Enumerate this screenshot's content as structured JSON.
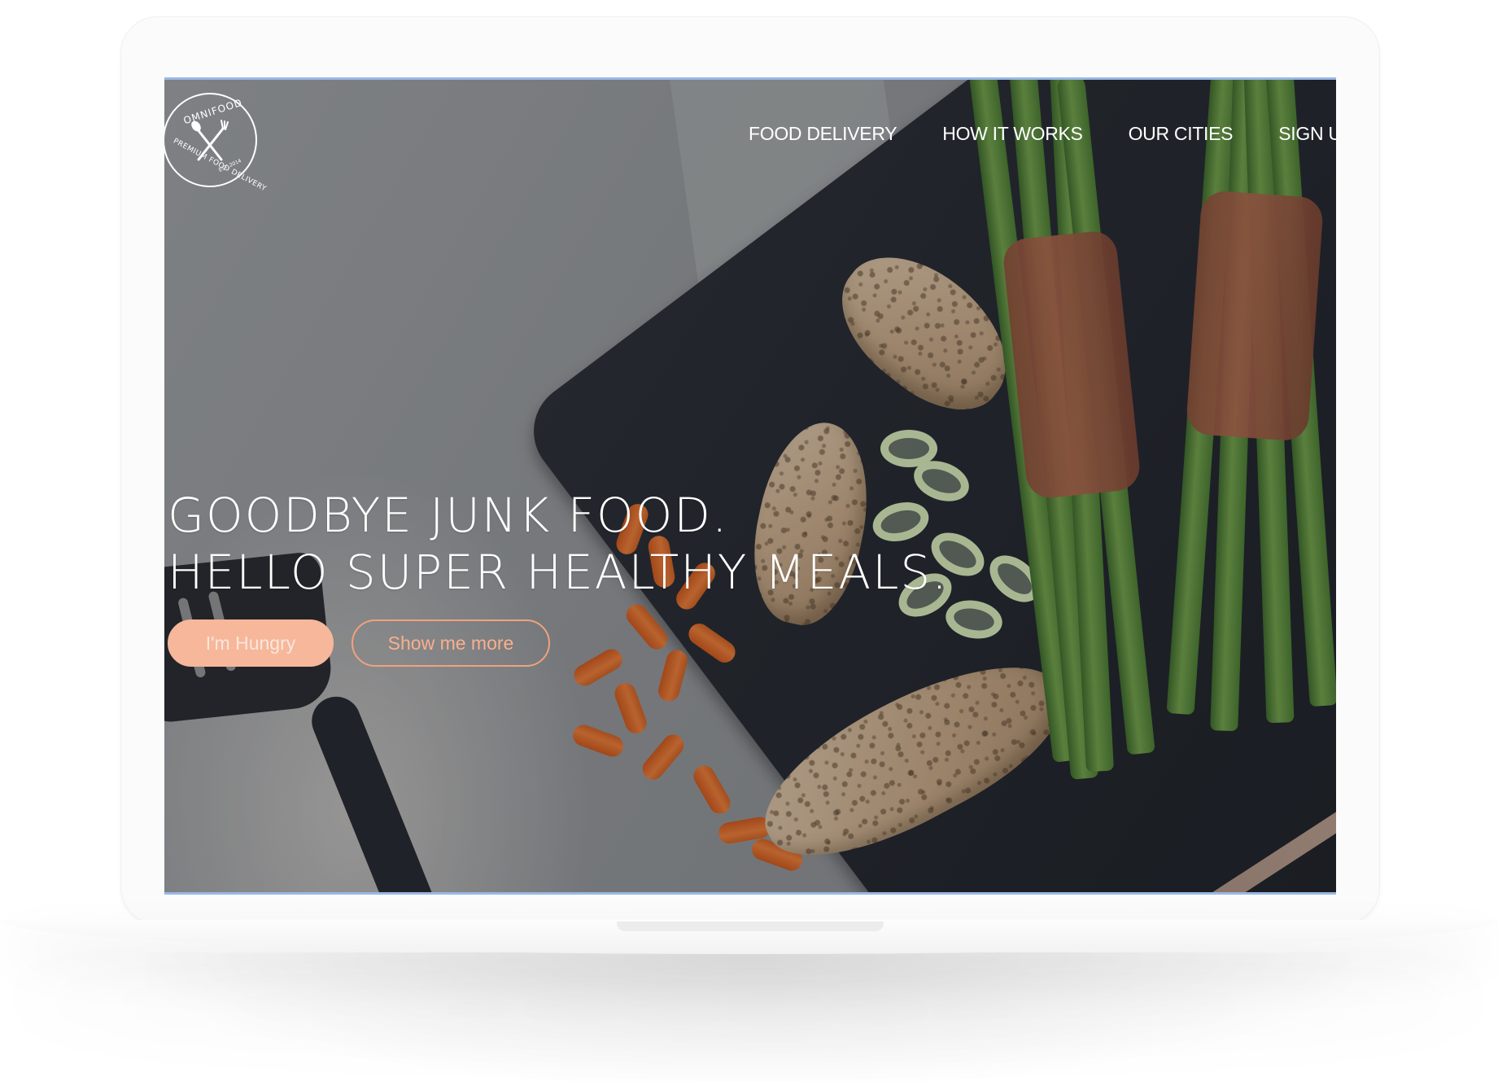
{
  "brand": {
    "name": "OMNIFOOD",
    "tagline": "PREMIUM FOOD DELIVERY",
    "established": "EST. 2014"
  },
  "nav": {
    "items": [
      {
        "label": "FOOD DELIVERY"
      },
      {
        "label": "HOW IT WORKS"
      },
      {
        "label": "OUR CITIES"
      },
      {
        "label": "SIGN U"
      }
    ]
  },
  "hero": {
    "line1": "GOODBYE JUNK FOOD.",
    "line2": "HELLO SUPER HEALTHY MEALS.",
    "primary_button": "I'm Hungry",
    "secondary_button": "Show me more"
  },
  "colors": {
    "accent": "#f6b79a",
    "accent_outline": "#f0a27e",
    "screen_border": "#9bb8e6",
    "text": "#ffffff"
  },
  "icons": {
    "logo": "crossed-fork-spoon-icon"
  }
}
